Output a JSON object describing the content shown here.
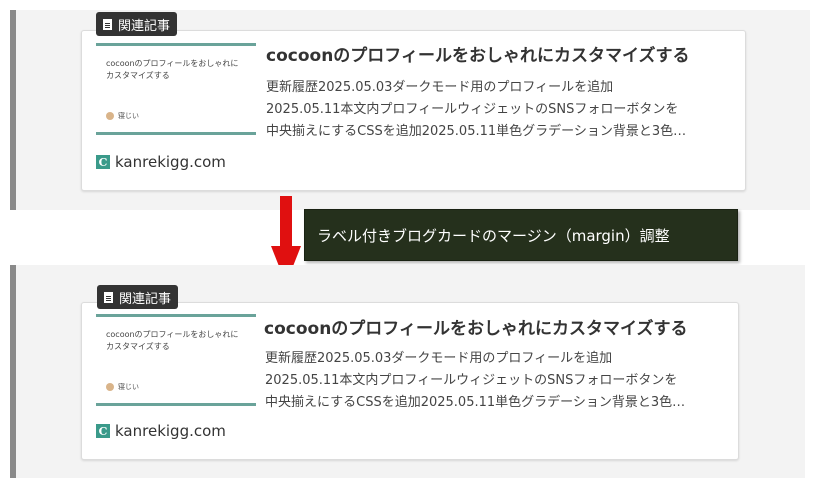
{
  "cards": {
    "top": {
      "label": "関連記事",
      "thumb_title": "cocoonのプロフィールをおしゃれにカスタマイズする",
      "thumb_author": "寝じい",
      "title": "cocoonのプロフィールをおしゃれにカスタマイズする",
      "snippet_line1": "更新履歴2025.05.03ダークモード用のプロフィールを追加",
      "snippet_line2": "2025.05.11本文内プロフィールウィジェットのSNSフォローボタンを",
      "snippet_line3": "中央揃えにするCSSを追加2025.05.11単色グラデーション背景と3色…",
      "site": "kanrekigg.com",
      "favicon_letter": "C"
    },
    "bottom": {
      "label": "関連記事",
      "thumb_title": "cocoonのプロフィールをおしゃれにカスタマイズする",
      "thumb_author": "寝じい",
      "title": "cocoonのプロフィールをおしゃれにカスタマイズする",
      "snippet_line1": "更新履歴2025.05.03ダークモード用のプロフィールを追加",
      "snippet_line2": "2025.05.11本文内プロフィールウィジェットのSNSフォローボタンを",
      "snippet_line3": "中央揃えにするCSSを追加2025.05.11単色グラデーション背景と3色…",
      "site": "kanrekigg.com",
      "favicon_letter": "C"
    }
  },
  "callout": {
    "text": "ラベル付きブログカードのマージン（margin）調整"
  },
  "icons": {
    "label_icon": "document-icon",
    "arrow": "down-arrow-icon"
  },
  "colors": {
    "arrow": "#e01010",
    "callout_bg": "#25301c",
    "thumb_accent": "#6aa39a",
    "favicon": "#3a9a8a"
  }
}
